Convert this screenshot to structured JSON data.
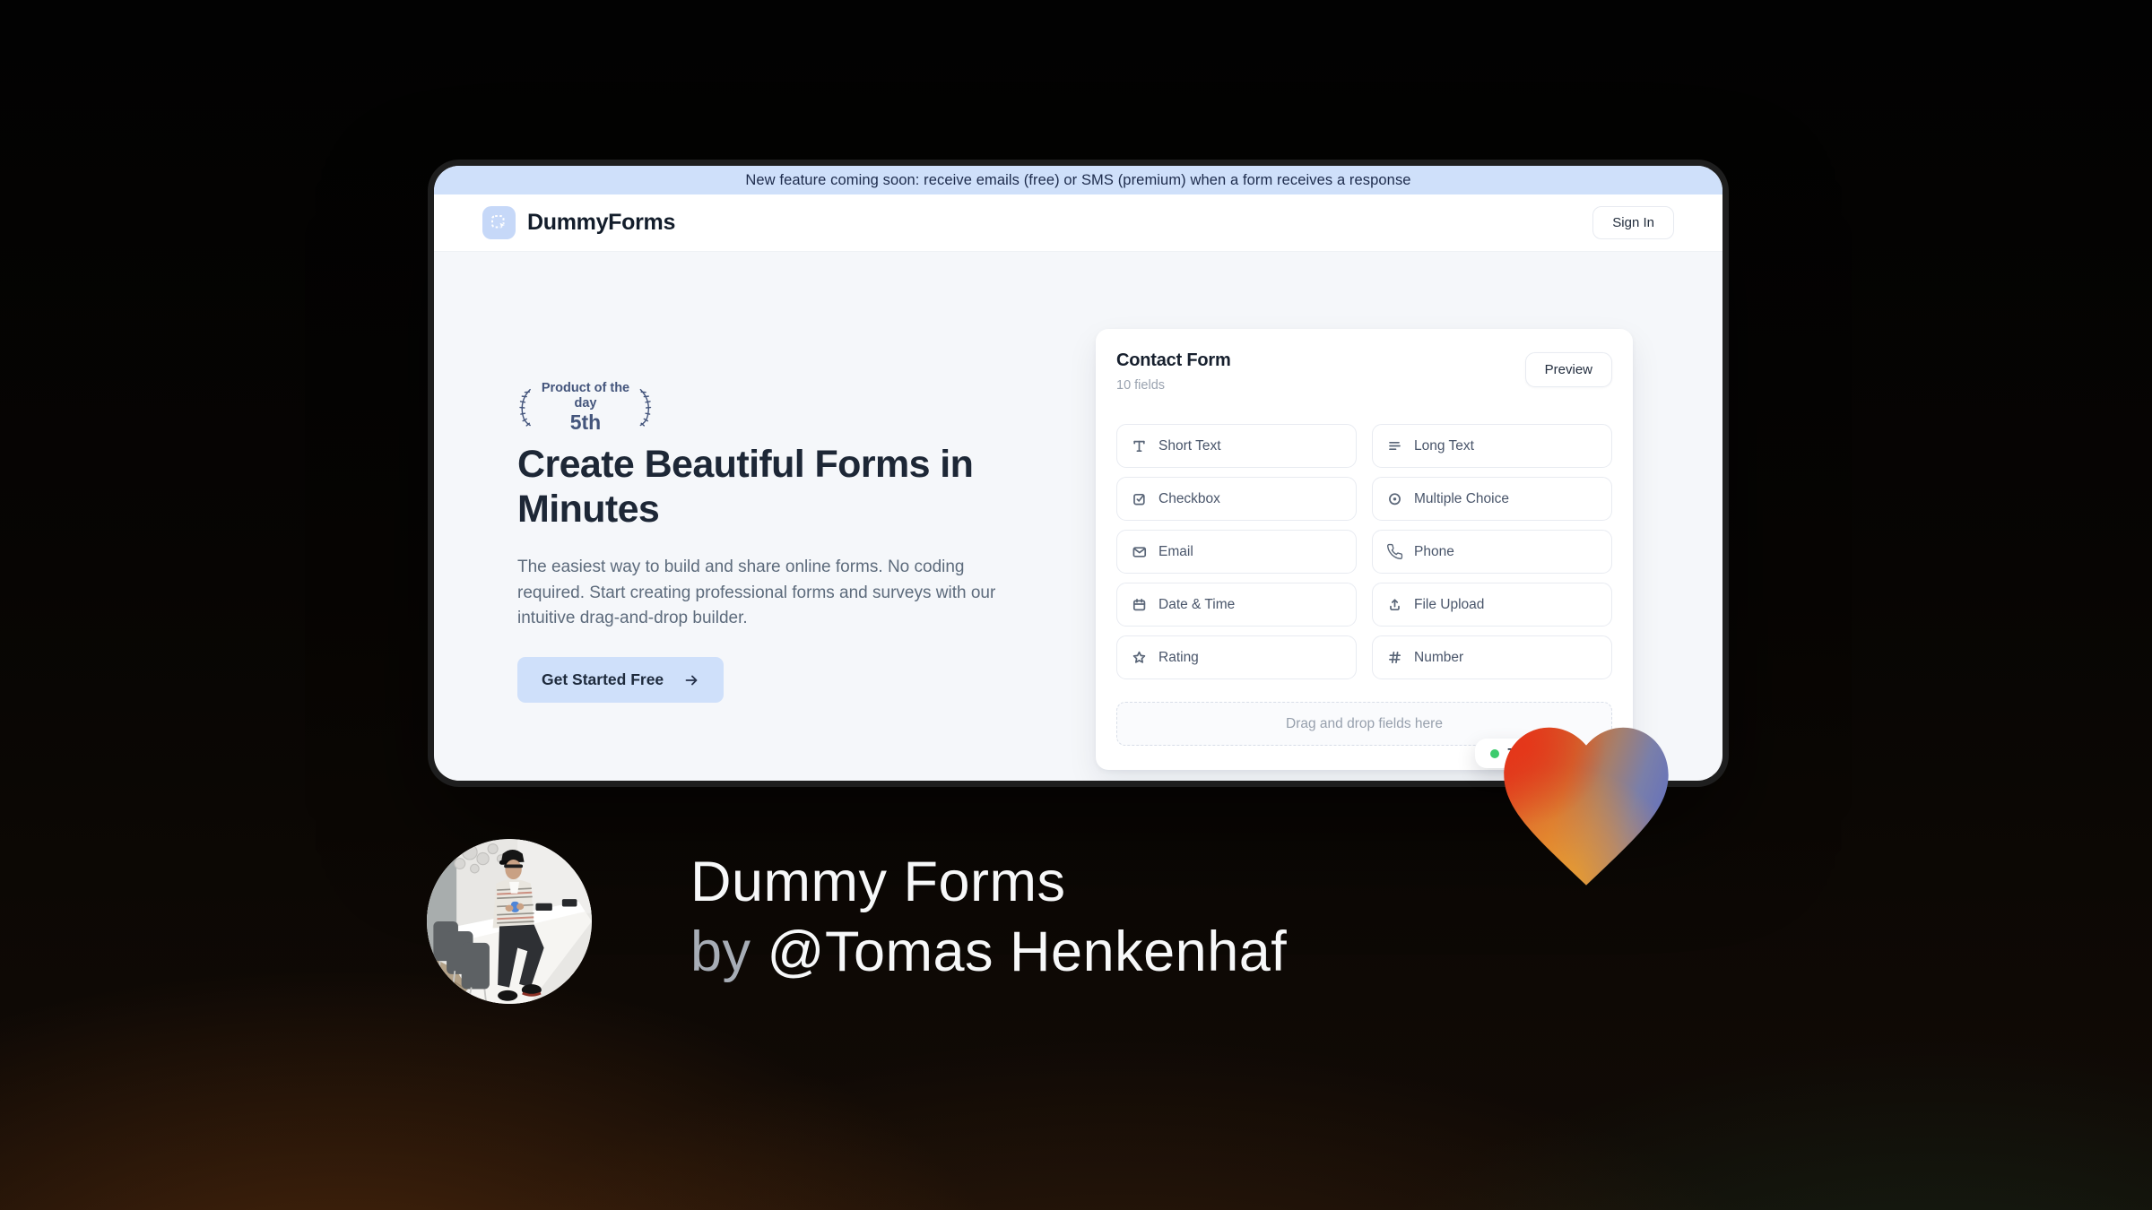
{
  "banner": {
    "text": "New feature coming soon: receive emails (free) or SMS (premium) when a form receives a response"
  },
  "header": {
    "brand": "DummyForms",
    "sign_in_label": "Sign In"
  },
  "hero": {
    "award": {
      "title": "Product of the day",
      "rank": "5th"
    },
    "heading": "Create Beautiful Forms in Minutes",
    "subheading": "The easiest way to build and share online forms. No coding required. Start creating professional forms and surveys with our intuitive drag-and-drop builder.",
    "cta_label": "Get Started Free"
  },
  "form_builder": {
    "title": "Contact Form",
    "field_count": "10 fields",
    "preview_label": "Preview",
    "field_types": [
      {
        "label": "Short Text",
        "icon": "type-icon"
      },
      {
        "label": "Long Text",
        "icon": "align-left-icon"
      },
      {
        "label": "Checkbox",
        "icon": "checkbox-icon"
      },
      {
        "label": "Multiple Choice",
        "icon": "radio-icon"
      },
      {
        "label": "Email",
        "icon": "mail-icon"
      },
      {
        "label": "Phone",
        "icon": "phone-icon"
      },
      {
        "label": "Date & Time",
        "icon": "calendar-icon"
      },
      {
        "label": "File Upload",
        "icon": "upload-icon"
      },
      {
        "label": "Rating",
        "icon": "star-icon"
      },
      {
        "label": "Number",
        "icon": "hash-icon"
      }
    ],
    "dropzone_text": "Drag and drop fields here",
    "status_badge": {
      "value": "77",
      "dot_color": "#3dcb6d"
    }
  },
  "footer": {
    "product_name": "Dummy Forms",
    "byline_prefix": "by ",
    "creator_handle": "@Tomas Henkenhaf"
  },
  "colors": {
    "accent_blue": "#cfe0fa",
    "navy_text": "#1d2736",
    "heart_red": "#e63a1c",
    "heart_orange": "#f09c2a",
    "heart_blue": "#6b77bb",
    "status_green": "#3dcb6d"
  }
}
